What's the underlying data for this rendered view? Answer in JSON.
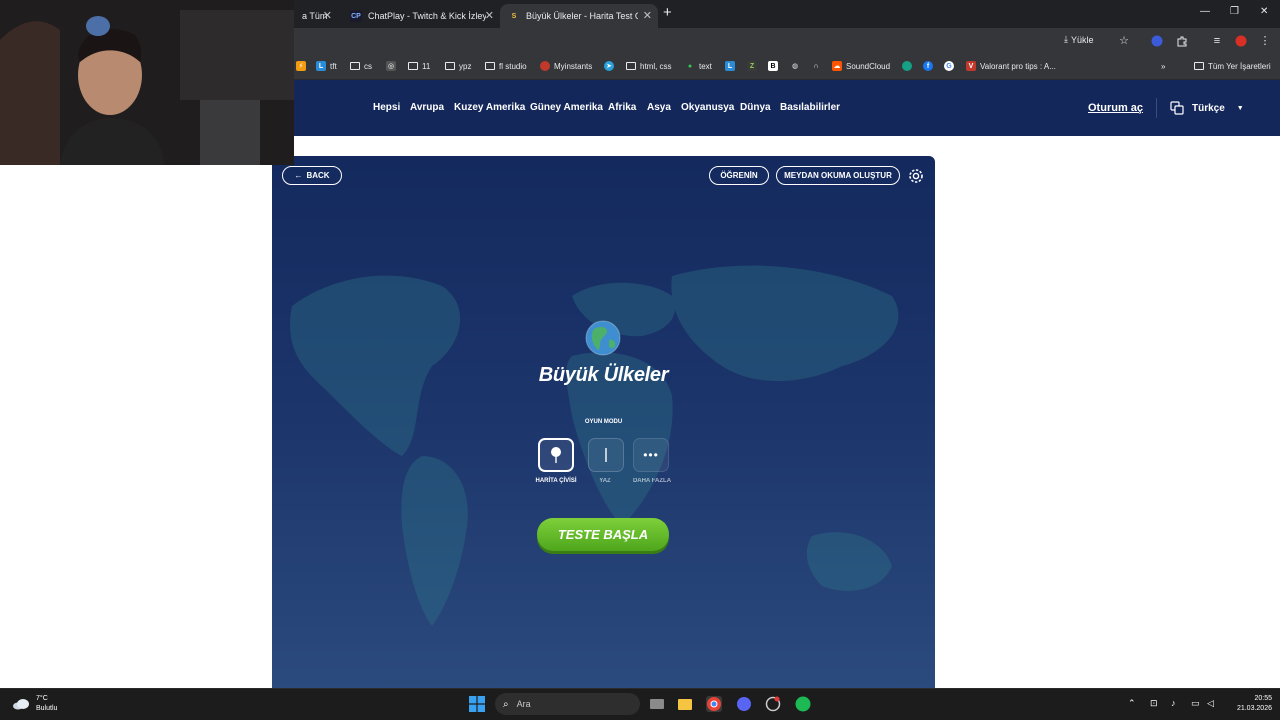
{
  "browser": {
    "tabs": [
      {
        "title": "a Tüm"
      },
      {
        "title": "ChatPlay - Twitch & Kick İzleyici"
      },
      {
        "title": "Büyük Ülkeler - Harita Test Oyunu",
        "active": true
      }
    ],
    "install_label": "Yükle",
    "bookmarks": [
      "tft",
      "cs",
      "11",
      "ypz",
      "fl studio",
      "Myinstants",
      "html, css",
      "text",
      "SoundCloud",
      "Valorant pro tips : A..."
    ],
    "all_bookmarks_label": "Tüm Yer İşaretleri"
  },
  "site": {
    "nav": [
      "Hepsi",
      "Avrupa",
      "Kuzey Amerika",
      "Güney Amerika",
      "Afrika",
      "Asya",
      "Okyanusya",
      "Dünya",
      "Basılabilirler"
    ],
    "login_label": "Oturum aç",
    "language": "Türkçe"
  },
  "game": {
    "back_label": "BACK",
    "learn_label": "ÖĞRENİN",
    "challenge_label": "MEYDAN OKUMA OLUŞTUR",
    "title": "Büyük Ülkeler",
    "mode_label": "OYUN MODU",
    "modes": [
      {
        "label": "HARİTA ÇİVİSİ",
        "icon": "pin-icon",
        "selected": true
      },
      {
        "label": "YAZ",
        "icon": "text-cursor-icon",
        "selected": false
      },
      {
        "label": "DAHA FAZLA",
        "icon": "more-icon",
        "selected": false
      }
    ],
    "start_label": "TESTE BAŞLA"
  },
  "taskbar": {
    "weather_temp": "7°C",
    "weather_desc": "Bulutlu",
    "search_placeholder": "Ara",
    "time": "20:55",
    "date": "21.03.2026"
  },
  "colors": {
    "header_bg": "#14275a",
    "panel_bg": "#1b346a",
    "start_button": "#5cb82a"
  }
}
